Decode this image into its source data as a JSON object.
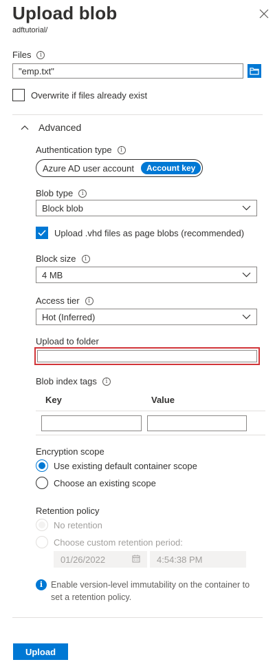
{
  "header": {
    "title": "Upload blob",
    "subtitle": "adftutorial/"
  },
  "files": {
    "label": "Files",
    "value": "\"emp.txt\""
  },
  "overwrite": {
    "label": "Overwrite if files already exist",
    "checked": false
  },
  "advanced": {
    "label": "Advanced",
    "expanded": true
  },
  "auth": {
    "label": "Authentication type",
    "options": [
      "Azure AD user account",
      "Account key"
    ],
    "selected": "Account key"
  },
  "blob_type": {
    "label": "Blob type",
    "value": "Block blob"
  },
  "vhd": {
    "label": "Upload .vhd files as page blobs (recommended)",
    "checked": true
  },
  "block_size": {
    "label": "Block size",
    "value": "4 MB"
  },
  "access_tier": {
    "label": "Access tier",
    "value": "Hot (Inferred)"
  },
  "folder": {
    "label": "Upload to folder",
    "value": ""
  },
  "tags": {
    "label": "Blob index tags",
    "columns": [
      "Key",
      "Value"
    ]
  },
  "encryption": {
    "label": "Encryption scope",
    "options": [
      "Use existing default container scope",
      "Choose an existing scope"
    ],
    "selected": 0
  },
  "retention": {
    "label": "Retention policy",
    "options": [
      "No retention",
      "Choose custom retention period:"
    ],
    "date": "01/26/2022",
    "time": "4:54:38 PM",
    "note": "Enable version-level immutability on the container to set a retention policy."
  },
  "actions": {
    "upload_label": "Upload"
  },
  "colors": {
    "accent": "#0078d4",
    "focus_border": "#d13438"
  }
}
